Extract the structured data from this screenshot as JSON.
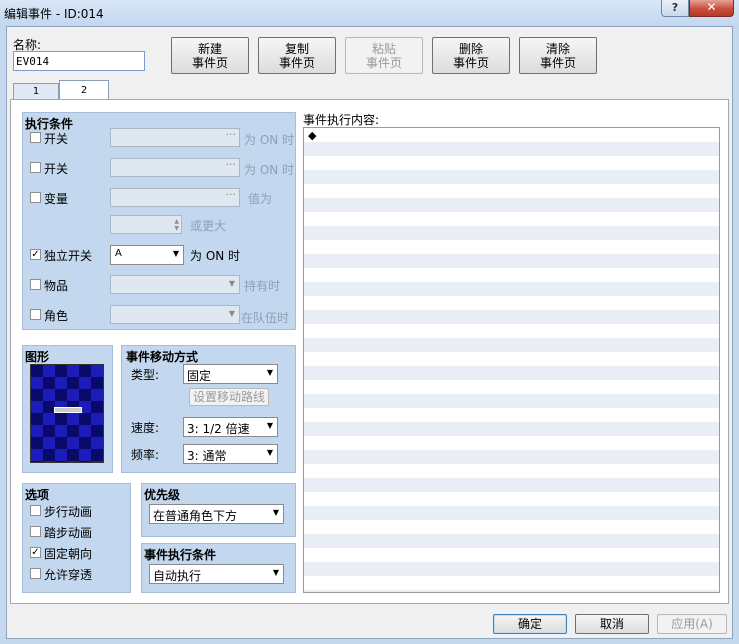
{
  "window": {
    "title": "编辑事件 - ID:014",
    "help": "?",
    "close": "✕"
  },
  "name": {
    "label": "名称:",
    "value": "EV014"
  },
  "page_buttons": [
    {
      "line1": "新建",
      "line2": "事件页"
    },
    {
      "line1": "复制",
      "line2": "事件页"
    },
    {
      "line1": "粘贴",
      "line2": "事件页"
    },
    {
      "line1": "删除",
      "line2": "事件页"
    },
    {
      "line1": "清除",
      "line2": "事件页"
    }
  ],
  "tabs": [
    {
      "label": "1"
    },
    {
      "label": "2"
    }
  ],
  "conditions": {
    "title": "执行条件",
    "switch1": {
      "label": "开关",
      "suffix": "为 ON 时"
    },
    "switch2": {
      "label": "开关",
      "suffix": "为 ON 时"
    },
    "variable": {
      "label": "变量",
      "suffix": "值为",
      "suffix2": "或更大"
    },
    "self_switch": {
      "label": "独立开关",
      "value": "A",
      "suffix": "为 ON 时"
    },
    "item": {
      "label": "物品",
      "suffix": "持有时"
    },
    "actor": {
      "label": "角色",
      "suffix": "在队伍时"
    }
  },
  "graphic": {
    "title": "图形"
  },
  "movement": {
    "title": "事件移动方式",
    "type_label": "类型:",
    "type_value": "固定",
    "route_btn": "设置移动路线",
    "speed_label": "速度:",
    "speed_value": "3: 1/2 倍速",
    "freq_label": "频率:",
    "freq_value": "3: 通常"
  },
  "options": {
    "title": "选项",
    "walk": "步行动画",
    "step": "踏步动画",
    "dirfix": "固定朝向",
    "through": "允许穿透"
  },
  "priority": {
    "title": "优先级",
    "value": "在普通角色下方"
  },
  "trigger": {
    "title": "事件执行条件",
    "value": "自动执行"
  },
  "contents": {
    "label": "事件执行内容:",
    "first": "◆"
  },
  "footer": {
    "ok": "确定",
    "cancel": "取消",
    "apply": "应用(A)"
  }
}
